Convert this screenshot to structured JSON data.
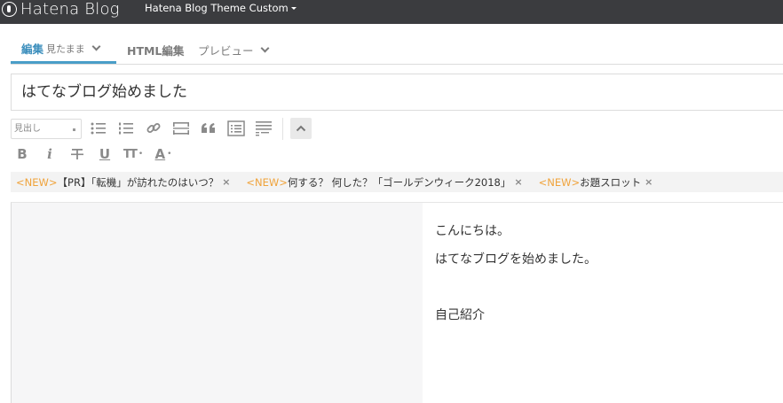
{
  "header": {
    "logo_text": "Hatena Blog",
    "blog_name": "Hatena Blog Theme Custom"
  },
  "tabs": {
    "edit_main": "編集",
    "edit_sub": "見たまま",
    "html": "HTML編集",
    "preview": "プレビュー"
  },
  "post": {
    "title": "はてなブログ始めました"
  },
  "toolbar": {
    "heading_select": "見出し",
    "buttons": [
      "bulleted-list",
      "numbered-list",
      "link",
      "read-more",
      "quote",
      "table-of-contents",
      "footnote",
      "collapse",
      "bold",
      "italic",
      "strikethrough",
      "underline",
      "text-size",
      "text-color"
    ],
    "bold": "B",
    "italic": "i",
    "underline": "U",
    "size": "TT",
    "color": "A"
  },
  "topics": [
    {
      "tag": "<NEW>",
      "label": "【PR】「転機」が訪れたのはいつ？"
    },
    {
      "tag": "<NEW>",
      "label": "何する？ 何した？「ゴールデンウィーク2018」"
    },
    {
      "tag": "<NEW>",
      "label": "お題スロット"
    }
  ],
  "content": {
    "line1": "こんにちは。",
    "line2": "はてなブログを始めました。",
    "line3": "自己紹介"
  },
  "colors": {
    "accent": "#4a9ec8",
    "topbar": "#3b3c3f",
    "new_tag": "#f0a33b"
  }
}
